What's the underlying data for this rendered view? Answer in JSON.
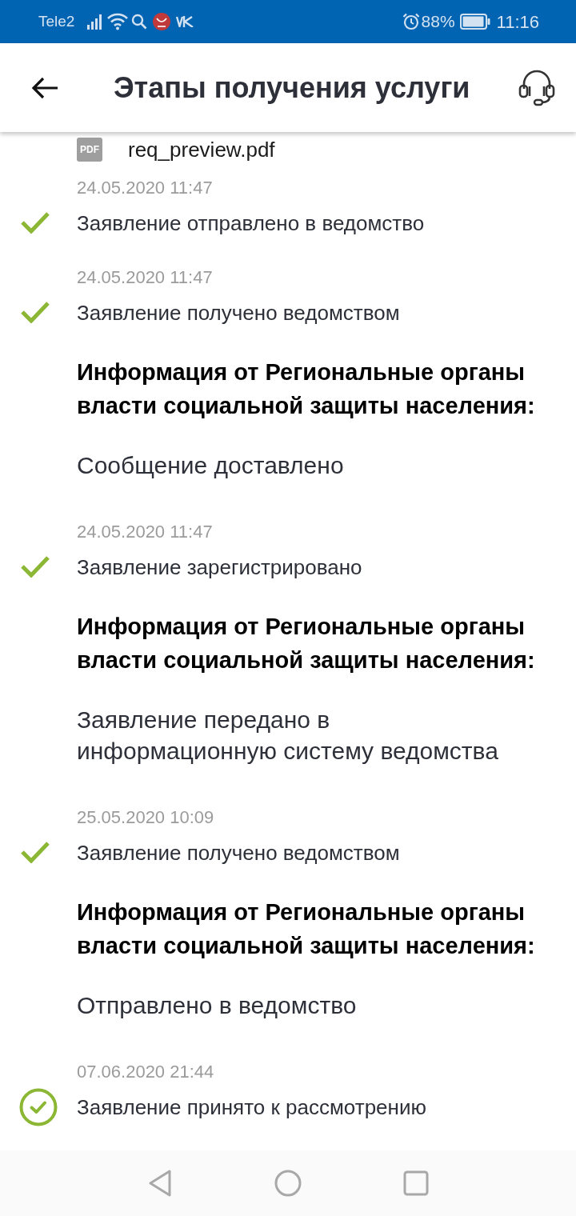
{
  "status_bar": {
    "carrier": "Tele2",
    "battery": "88%",
    "time": "11:16"
  },
  "header": {
    "title": "Этапы получения услуги"
  },
  "attachment": {
    "type_label": "PDF",
    "file_name": "req_preview.pdf"
  },
  "stages": [
    {
      "date": "24.05.2020 11:47",
      "kind": "done",
      "status": "Заявление отправлено в ведомство"
    },
    {
      "date": "24.05.2020 11:47",
      "kind": "done",
      "status": "Заявление получено ведомством",
      "info": {
        "heading": "Информация от Региональные органы власти социальной защиты населения:",
        "message": "Сообщение доставлено"
      }
    },
    {
      "date": "24.05.2020 11:47",
      "kind": "done",
      "status": "Заявление зарегистрировано",
      "info": {
        "heading": "Информация от Региональные органы власти социальной защиты населения:",
        "message": "Заявление передано в информационную систему ведомства"
      }
    },
    {
      "date": "25.05.2020 10:09",
      "kind": "done",
      "status": "Заявление получено ведомством",
      "info": {
        "heading": "Информация от Региональные органы власти социальной защиты населения:",
        "message": "Отправлено в ведомство"
      }
    },
    {
      "date": "07.06.2020 21:44",
      "kind": "current",
      "status": "Заявление принято к рассмотрению"
    }
  ]
}
